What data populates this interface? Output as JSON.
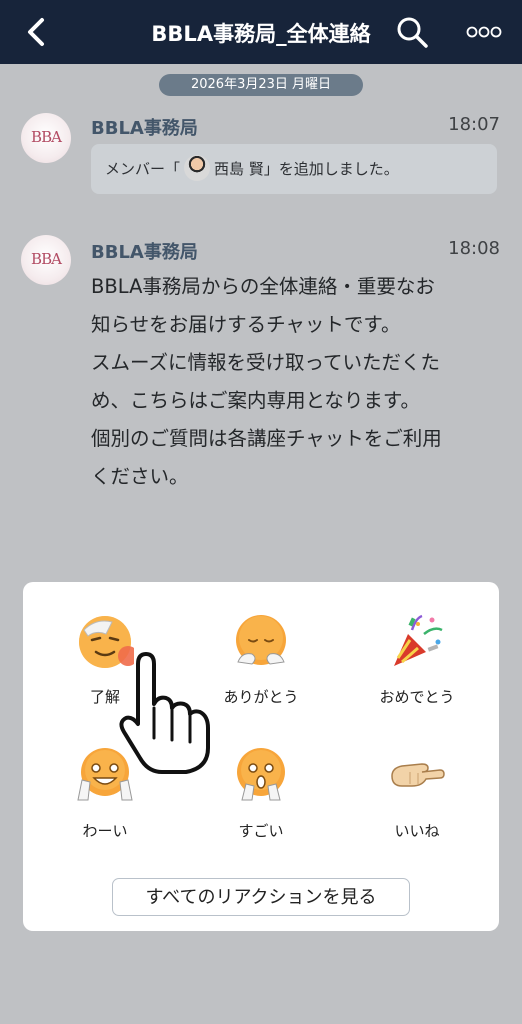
{
  "header": {
    "title": "BBLA事務局_全体連絡",
    "back_icon": "chevron-left-icon",
    "search_icon": "search-icon",
    "more_icon": "more-horizontal-icon"
  },
  "chat": {
    "date": "2026年3月23日 月曜日",
    "messages": [
      {
        "sender": "BBLA事務局",
        "time": "18:07",
        "avatar_text": "BBA",
        "system_prefix": "メンバー「",
        "system_name": "西島 賢",
        "system_suffix": "」を追加しました。"
      },
      {
        "sender": "BBLA事務局",
        "time": "18:08",
        "avatar_text": "BBA",
        "text": "BBLA事務局からの全体連絡・重要なお\n知らせをお届けするチャットです。\nスムーズに情報を受け取っていただくた\nめ、こちらはご案内専用となります。\n個別のご質問は各講座チャットをご利用\nください。"
      }
    ]
  },
  "reactions": {
    "items": [
      {
        "label": "了解",
        "icon": "salute-emoji-icon"
      },
      {
        "label": "ありがとう",
        "icon": "bowing-emoji-icon"
      },
      {
        "label": "おめでとう",
        "icon": "party-popper-icon"
      },
      {
        "label": "わーい",
        "icon": "happy-emoji-icon"
      },
      {
        "label": "すごい",
        "icon": "amazed-emoji-icon"
      },
      {
        "label": "いいね",
        "icon": "thumbs-up-hand-icon"
      }
    ],
    "see_all_label": "すべてのリアクションを見る"
  },
  "colors": {
    "topbar": "#17243a",
    "background": "#bfc1c4",
    "date_pill": "#6b7b8a",
    "sender_name": "#43566a",
    "emoji_face": "#f7a53a",
    "tap_indicator": "#ef6b4a"
  }
}
